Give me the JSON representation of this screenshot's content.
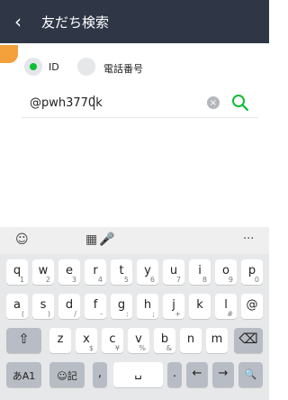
{
  "header": {
    "back_icon": "chevron-left-icon",
    "title": "友だち検索"
  },
  "search_type": {
    "id_label": "ID",
    "tel_label": "電話番号",
    "selected": "ID"
  },
  "search": {
    "value": "@pwh3770k",
    "clear_icon": "clear-icon",
    "search_icon": "search-icon"
  },
  "keyboard": {
    "toolbar": {
      "face_icon": "face-icon",
      "text_icon": "text-grid-icon",
      "mic_icon": "mic-icon",
      "more_icon": "more-icon",
      "more": "···"
    },
    "row1": [
      "q",
      "w",
      "e",
      "r",
      "t",
      "y",
      "u",
      "i",
      "o",
      "p"
    ],
    "row1_sub": [
      "1",
      "2",
      "3",
      "4",
      "5",
      "6",
      "7",
      "8",
      "9",
      "0"
    ],
    "row2": [
      "a",
      "s",
      "d",
      "f",
      "g",
      "h",
      "j",
      "k",
      "l",
      "@"
    ],
    "row2_sub": [
      "(",
      ")",
      "/",
      "-",
      ":",
      ";",
      "+",
      "",
      "#",
      ""
    ],
    "row3": [
      "z",
      "x",
      "c",
      "v",
      "b",
      "n",
      "m"
    ],
    "row3_sub": [
      "",
      "$",
      "¥",
      "%",
      "&",
      "",
      "",
      ""
    ],
    "row4": {
      "lang": "あA1",
      "emoji": "☺記",
      "comma": ",",
      "space": "␣",
      "period": ".",
      "left": "←",
      "right": "→",
      "search": "🔍"
    },
    "shift_icon": "shift-icon",
    "backspace_icon": "backspace-icon"
  }
}
